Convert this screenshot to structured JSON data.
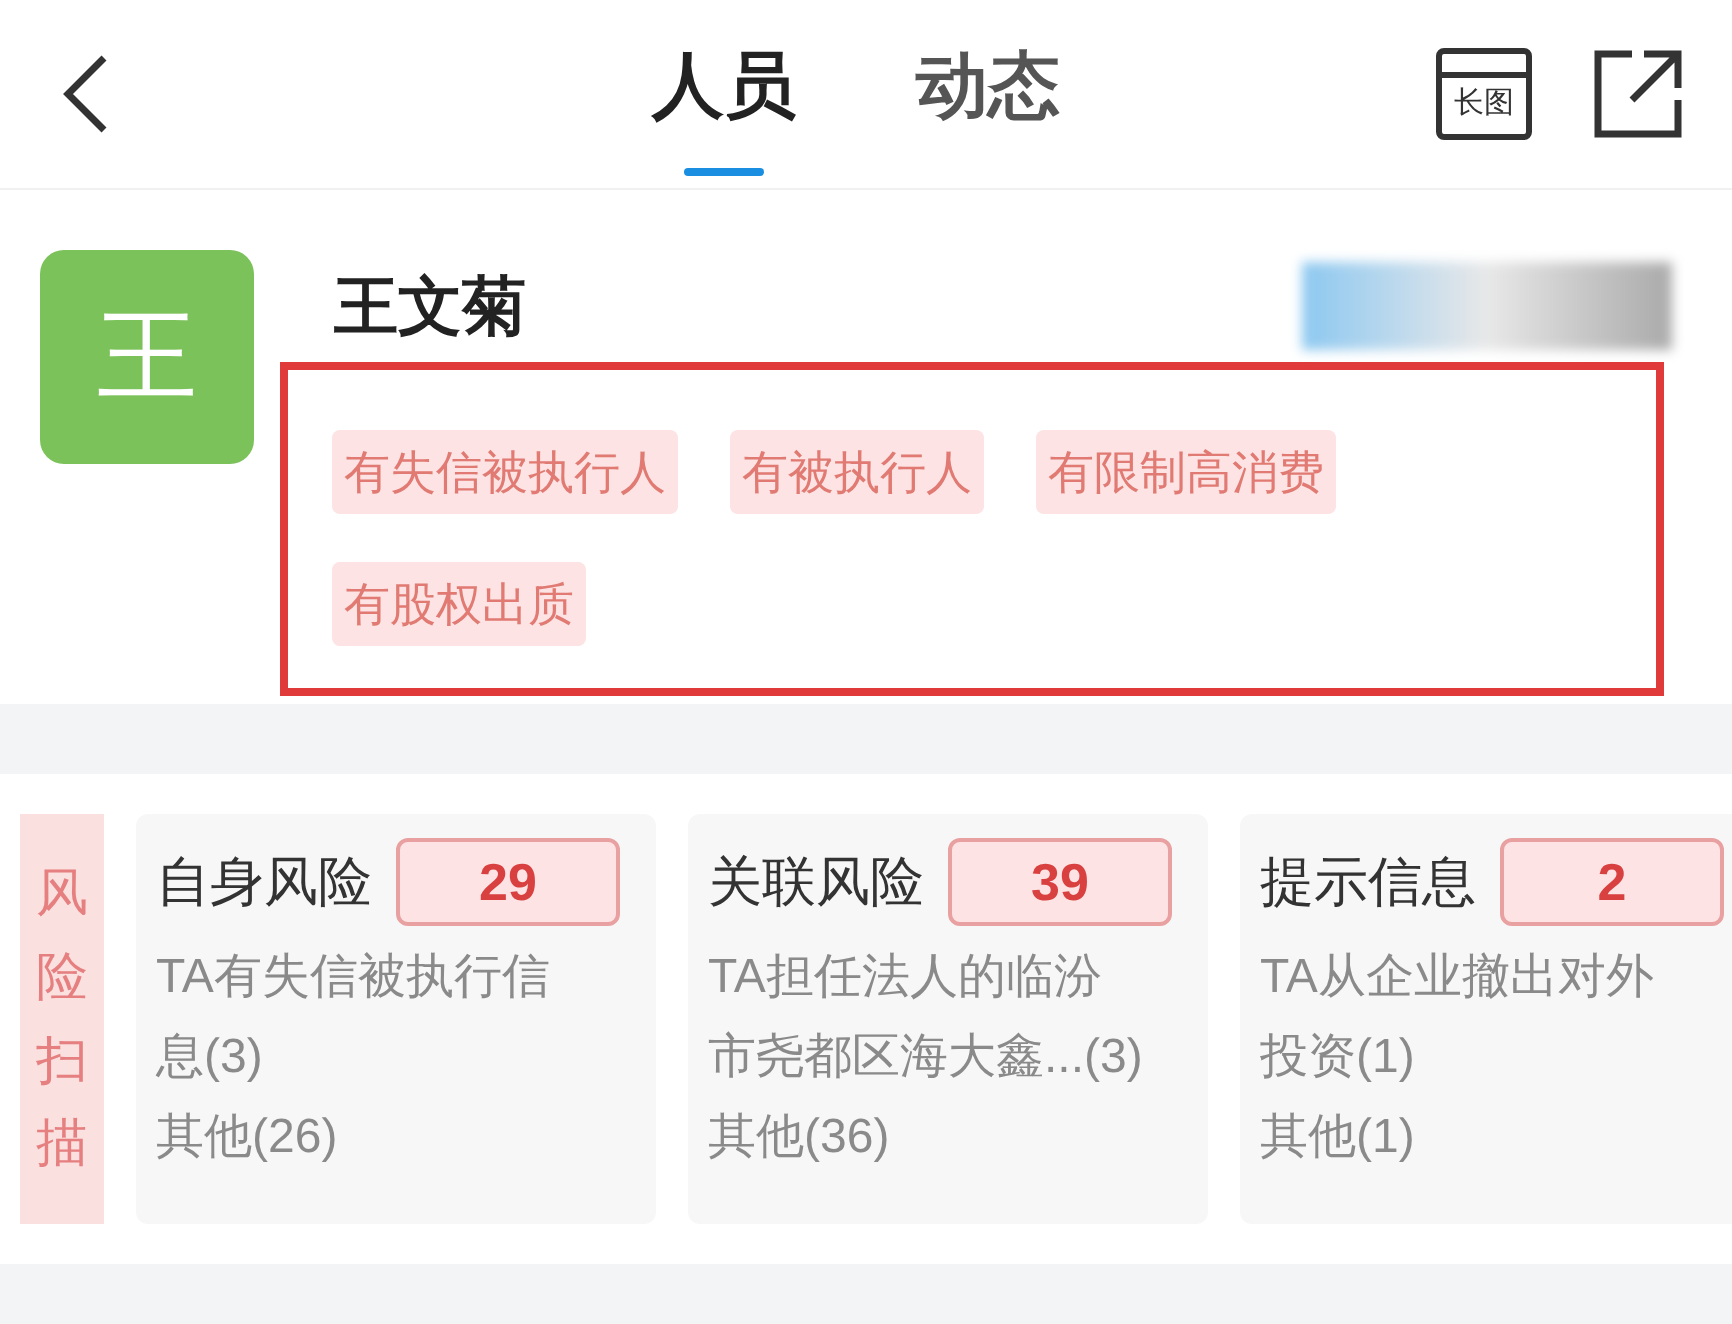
{
  "header": {
    "tabs": [
      {
        "label": "人员",
        "selected": true
      },
      {
        "label": "动态",
        "selected": false
      }
    ],
    "long_image_icon_text": "长图"
  },
  "profile": {
    "avatar_text": "王",
    "name": "王文菊",
    "tags": [
      "有失信被执行人",
      "有被执行人",
      "有限制高消费",
      "有股权出质"
    ]
  },
  "risk_scan": {
    "label": "风险扫描",
    "cards": [
      {
        "title": "自身风险",
        "count": "29",
        "description_lines": [
          "TA有失信被执行信",
          "息(3)"
        ],
        "other": "其他(26)"
      },
      {
        "title": "关联风险",
        "count": "39",
        "description_lines": [
          "TA担任法人的临汾",
          "市尧都区海大鑫...(3)"
        ],
        "other": "其他(36)"
      },
      {
        "title": "提示信息",
        "count": "2",
        "description_lines": [
          "TA从企业撤出对外",
          "投资(1)"
        ],
        "other": "其他(1)"
      }
    ]
  }
}
